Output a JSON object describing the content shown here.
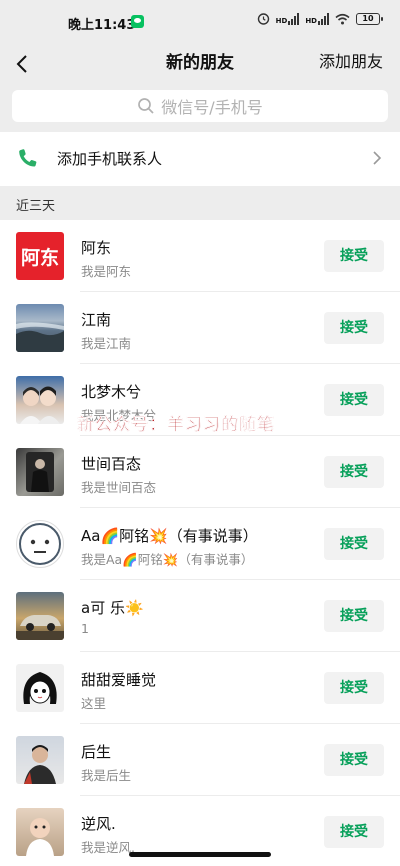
{
  "status_bar": {
    "time": "晚上11:43",
    "signal_1": "HD",
    "signal_2": "HD",
    "battery": "10"
  },
  "nav": {
    "title": "新的朋友",
    "action": "添加朋友"
  },
  "search": {
    "placeholder": "微信号/手机号"
  },
  "add_contacts": {
    "label": "添加手机联系人"
  },
  "section": {
    "label": "近三天"
  },
  "accept_label": "接受",
  "requests": [
    {
      "name": "阿东",
      "message": "我是阿东",
      "avatar_text": "阿东",
      "avatar_icon": "red-text-avatar"
    },
    {
      "name": "江南",
      "message": "我是江南",
      "avatar_icon": "seascape-photo-avatar"
    },
    {
      "name": "北梦木兮",
      "message": "我是北梦木兮",
      "avatar_icon": "couple-photo-avatar"
    },
    {
      "name": "世间百态",
      "message": "我是世间百态",
      "avatar_icon": "mirror-selfie-avatar"
    },
    {
      "name": "Aa🌈阿铭💥（有事说事）",
      "message": "我是Aa🌈阿铭💥（有事说事）",
      "avatar_icon": "neutral-face-avatar"
    },
    {
      "name": "a可 乐☀️",
      "message": "1",
      "avatar_icon": "car-photo-avatar"
    },
    {
      "name": "甜甜爱睡觉",
      "message": "这里",
      "avatar_icon": "anime-girl-avatar"
    },
    {
      "name": "后生",
      "message": "我是后生",
      "avatar_icon": "man-portrait-avatar"
    },
    {
      "name": "逆风.",
      "message": "我是逆风.",
      "avatar_icon": "baby-photo-avatar"
    }
  ],
  "watermark": "新公众号：羊习习的随笔",
  "colors": {
    "accent_green": "#07c160",
    "accept_text": "#07a05a",
    "background": "#ededed",
    "watermark": "#b30d12"
  }
}
